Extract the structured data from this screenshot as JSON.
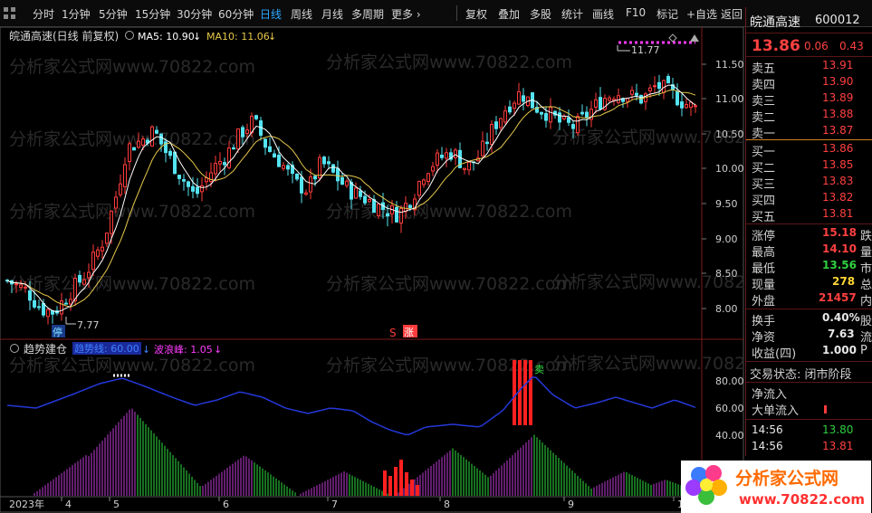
{
  "toolbar": {
    "periods": [
      "分时",
      "1分钟",
      "5分钟",
      "15分钟",
      "30分钟",
      "60分钟",
      "日线",
      "周线",
      "月线",
      "多周期",
      "更多 ›"
    ],
    "active_period": "日线",
    "tools": [
      "复权",
      "叠加",
      "多股",
      "统计",
      "画线",
      "F10",
      "标记",
      "+自选",
      "返回"
    ]
  },
  "main_panel": {
    "title": "皖通高速(日线 前复权)",
    "ma5_label": "MA5: 10.90",
    "ma10_label": "MA10: 11.06",
    "ma_arrow": "↓",
    "price_ticks": [
      "11.50",
      "11.00",
      "10.50",
      "10.00",
      "9.50",
      "9.00",
      "8.50",
      "8.00"
    ],
    "high_marker": "11.77",
    "low_marker": "7.77",
    "stop_tag": "停",
    "s_tag": "S",
    "rise_tag": "涨",
    "watermark": "分析家公式网www.70822.com"
  },
  "indicator_panel": {
    "title": "趋势建仓",
    "label1": "趋势线: 60.00",
    "label2": "波浪峰: 1.05",
    "arrow": "↓",
    "ticks": [
      "80.00",
      "60.00",
      "40.00"
    ],
    "signal_tag": "卖"
  },
  "time_axis": [
    "2023年",
    "4",
    "5",
    "6",
    "7",
    "8",
    "9",
    "1"
  ],
  "quote": {
    "name": "皖通高速",
    "code": "600012",
    "price": "13.86",
    "change": "0.06",
    "change_pct": "0.43",
    "asks": [
      {
        "label": "卖五",
        "price": "13.91"
      },
      {
        "label": "卖四",
        "price": "13.90"
      },
      {
        "label": "卖三",
        "price": "13.89"
      },
      {
        "label": "卖二",
        "price": "13.88"
      },
      {
        "label": "卖一",
        "price": "13.87"
      }
    ],
    "bids": [
      {
        "label": "买一",
        "price": "13.86"
      },
      {
        "label": "买二",
        "price": "13.85"
      },
      {
        "label": "买三",
        "price": "13.83"
      },
      {
        "label": "买四",
        "price": "13.82"
      },
      {
        "label": "买五",
        "price": "13.81"
      }
    ],
    "stats": [
      {
        "label": "涨停",
        "value": "15.18",
        "tail": "跌"
      },
      {
        "label": "最高",
        "value": "14.10",
        "tail": "量"
      },
      {
        "label": "最低",
        "value": "13.56",
        "tail": "市"
      },
      {
        "label": "现量",
        "value": "278",
        "tail": "总"
      },
      {
        "label": "外盘",
        "value": "21457",
        "tail": "内"
      }
    ],
    "stats2": [
      {
        "label": "换手",
        "value": "0.40%",
        "tail": "股"
      },
      {
        "label": "净资",
        "value": "7.63",
        "tail": "流"
      },
      {
        "label": "收益(四)",
        "value": "1.000",
        "tail": "P"
      }
    ],
    "status": "交易状态: 闭市阶段",
    "flow": [
      {
        "label": "净流入"
      },
      {
        "label": "大单流入"
      }
    ],
    "ticks": [
      {
        "time": "14:56",
        "price": "13.80"
      },
      {
        "time": "14:56",
        "price": "13.81"
      }
    ]
  },
  "logo": {
    "text": "分析家公式网",
    "url": "www.70822.com"
  },
  "colors": {
    "up": "#ff3b3b",
    "down": "#54e3f0",
    "ma5": "#ffffff",
    "ma10": "#e6c84a",
    "trend": "#2438d8",
    "pink": "#ff3cff",
    "green": "#30e040",
    "magenta_peak": "#c23dd9"
  }
}
